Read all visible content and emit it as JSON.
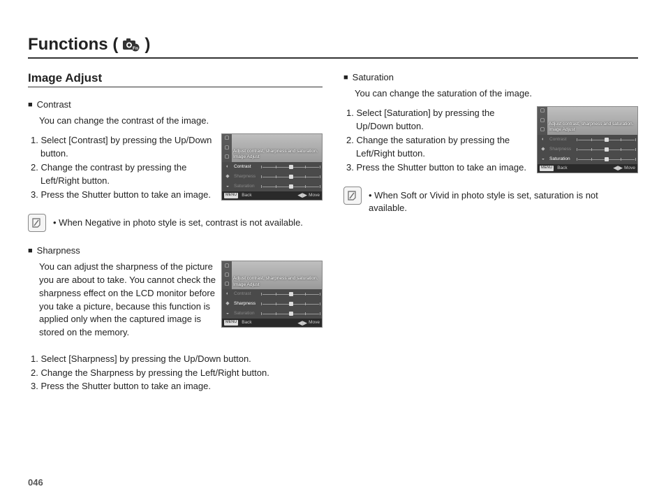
{
  "title_prefix": "Functions (",
  "title_suffix": ")",
  "section_title": "Image Adjust",
  "page_number": "046",
  "thumb_common": {
    "overlay_line1": "Adjust contrast, sharpness and saturation.",
    "overlay_line2": "Image Adjust",
    "row_contrast": "Contrast",
    "row_sharpness": "Sharpness",
    "row_saturation": "Saturation",
    "footer_back_btn": "MENU",
    "footer_back": "Back",
    "footer_move": "Move"
  },
  "contrast": {
    "name": "Contrast",
    "desc": "You can change the contrast of the image.",
    "steps": [
      "1. Select [Contrast] by pressing the Up/Down button.",
      "2. Change the contrast by pressing the Left/Right button.",
      "3. Press the Shutter button to take an image."
    ],
    "note": "When Negative in photo style is set, contrast is not available."
  },
  "sharpness": {
    "name": "Sharpness",
    "desc": "You can adjust the sharpness of the picture you are about to take. You cannot check the sharpness effect on the LCD monitor before you take a picture, because this function is applied only when the captured image is stored on the memory.",
    "steps": [
      "1. Select [Sharpness] by pressing the Up/Down button.",
      "2. Change the Sharpness by pressing the Left/Right button.",
      "3. Press the Shutter button to take an image."
    ]
  },
  "saturation": {
    "name": "Saturation",
    "desc": "You can change the saturation of the image.",
    "steps": [
      "1. Select [Saturation] by pressing the Up/Down button.",
      "2. Change the saturation by pressing the Left/Right button.",
      "3. Press the Shutter button to take an image."
    ],
    "note": "When Soft or Vivid in photo style is set, saturation is not available."
  }
}
